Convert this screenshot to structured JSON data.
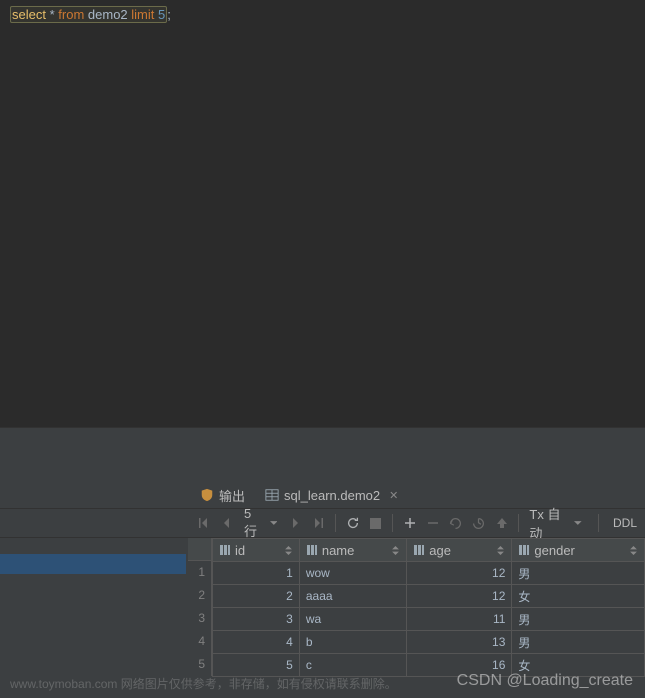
{
  "sql": {
    "kw_select": "select",
    "star": "*",
    "kw_from": "from",
    "table": "demo2",
    "kw_limit": "limit",
    "num": "5",
    "semi": ";"
  },
  "tabs": {
    "output_label": "输出",
    "data_label": "sql_learn.demo2"
  },
  "toolbar": {
    "row_count": "5 行",
    "tx_label": "Tx 自动",
    "ddl_label": "DDL"
  },
  "columns": {
    "id": "id",
    "name": "name",
    "age": "age",
    "gender": "gender"
  },
  "rows": [
    {
      "n": "1",
      "id": "1",
      "name": "wow",
      "age": "12",
      "gender": "男"
    },
    {
      "n": "2",
      "id": "2",
      "name": "aaaa",
      "age": "12",
      "gender": "女"
    },
    {
      "n": "3",
      "id": "3",
      "name": "wa",
      "age": "11",
      "gender": "男"
    },
    {
      "n": "4",
      "id": "4",
      "name": "b",
      "age": "13",
      "gender": "男"
    },
    {
      "n": "5",
      "id": "5",
      "name": "c",
      "age": "16",
      "gender": "女"
    }
  ],
  "watermark1": "www.toymoban.com 网络图片仅供参考，非存储，如有侵权请联系删除。",
  "watermark2": "CSDN @Loading_create"
}
